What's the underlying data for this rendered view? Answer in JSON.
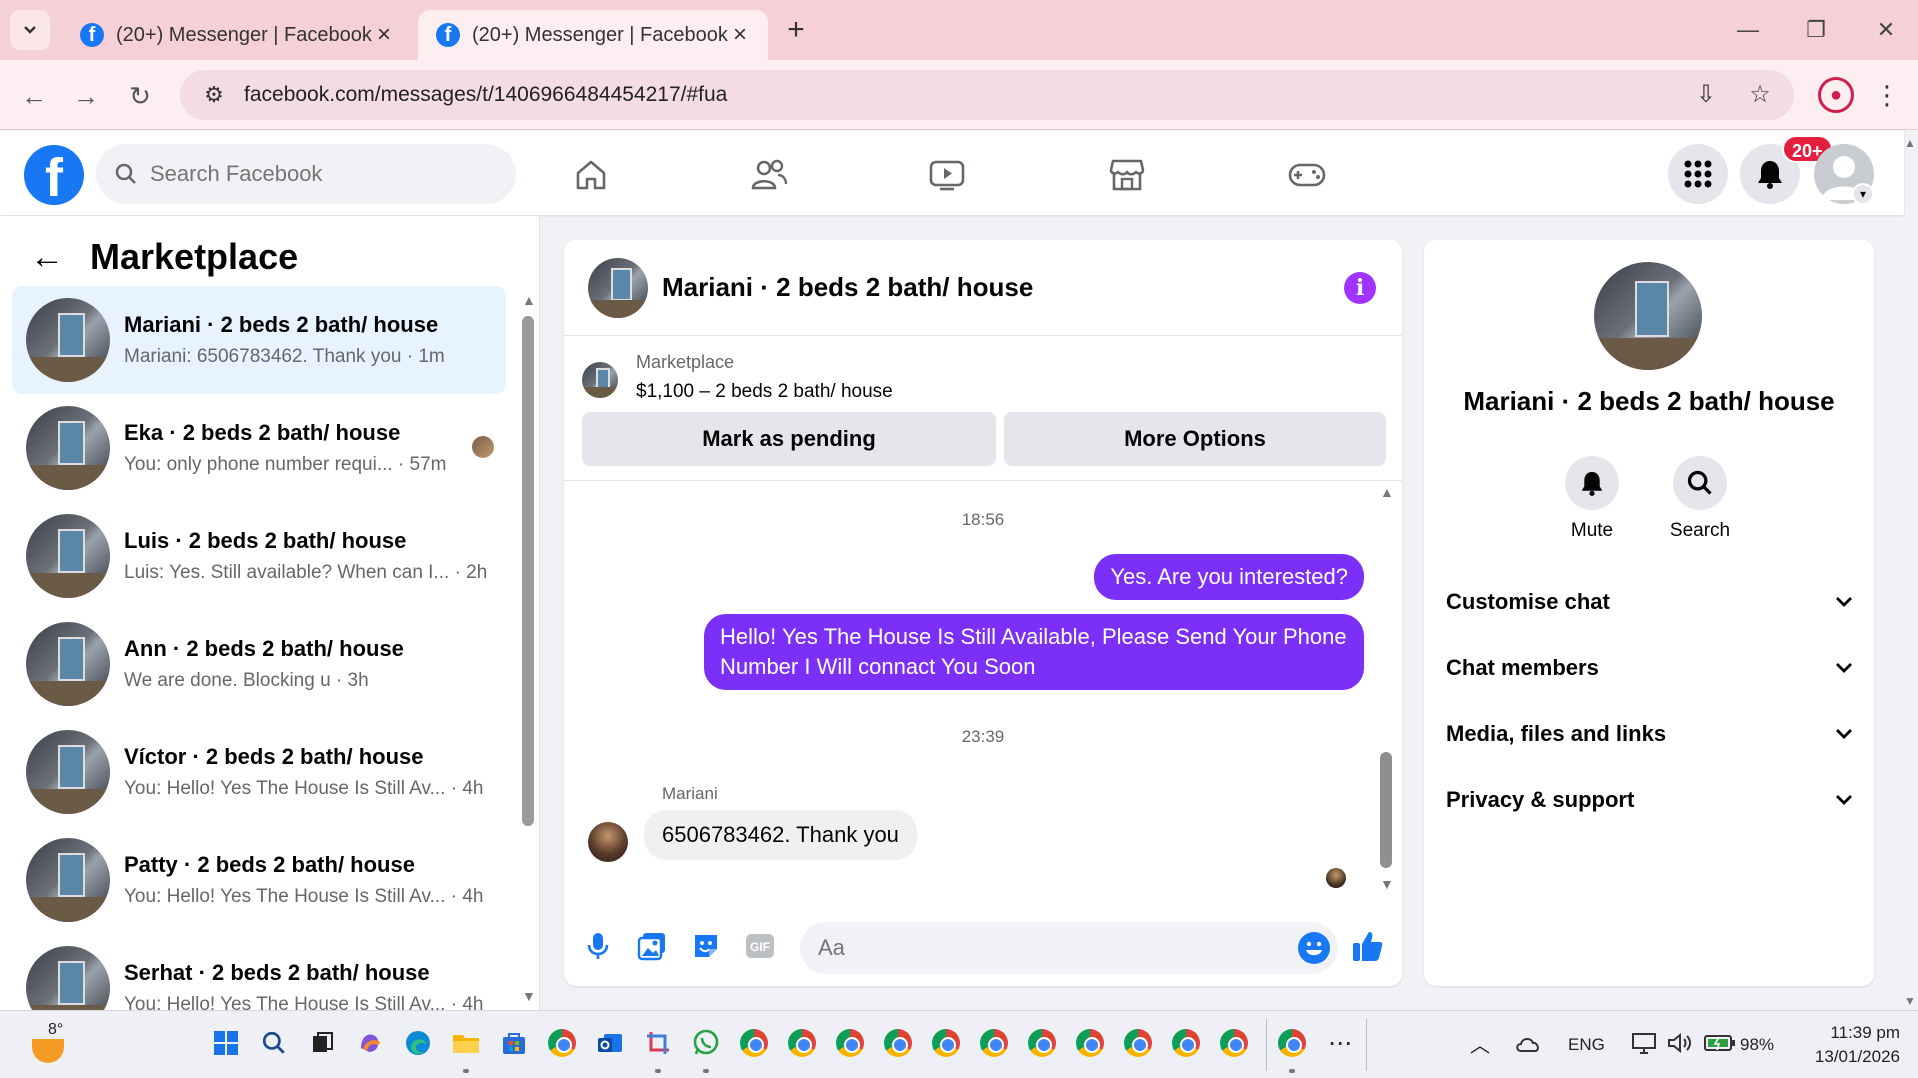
{
  "browser": {
    "tabs": [
      {
        "title": "(20+) Messenger | Facebook",
        "active": false
      },
      {
        "title": "(20+) Messenger | Facebook",
        "active": true
      }
    ],
    "url": "facebook.com/messages/t/1406966484454217/#fua"
  },
  "header": {
    "search_placeholder": "Search Facebook",
    "notification_badge": "20+"
  },
  "sidebar": {
    "title": "Marketplace",
    "conversations": [
      {
        "name": "Mariani · 2 beds 2 bath/ house",
        "preview": "Mariani: 6506783462. Thank you · 1m",
        "selected": true
      },
      {
        "name": "Eka · 2 beds 2 bath/ house",
        "preview": "You: only phone number requi... · 57m",
        "selected": false
      },
      {
        "name": "Luis · 2 beds 2 bath/ house",
        "preview": "Luis: Yes. Still available? When can I... · 2h",
        "selected": false
      },
      {
        "name": "Ann · 2 beds 2 bath/ house",
        "preview": "We are done. Blocking u · 3h",
        "selected": false
      },
      {
        "name": "Víctor · 2 beds 2 bath/ house",
        "preview": "You: Hello! Yes The House Is Still Av... · 4h",
        "selected": false
      },
      {
        "name": "Patty · 2 beds 2 bath/ house",
        "preview": "You: Hello! Yes The House Is Still Av... · 4h",
        "selected": false
      },
      {
        "name": "Serhat · 2 beds 2 bath/ house",
        "preview": "You: Hello! Yes The House Is Still Av... · 4h",
        "selected": false
      }
    ]
  },
  "chat": {
    "title": "Mariani · 2 beds 2 bath/ house",
    "listing_label": "Marketplace",
    "listing_price": "$1,100 – 2 beds 2 bath/ house",
    "mark_pending_label": "Mark as pending",
    "more_options_label": "More Options",
    "time1": "18:56",
    "msg_out_1": "Yes. Are you interested?",
    "msg_out_2": "Hello! Yes The House  Is Still Available, Please Send Your Phone Number I Will connact You Soon",
    "time2": "23:39",
    "sender_name": "Mariani",
    "msg_in_1": "6506783462. Thank you",
    "composer_placeholder": "Aa"
  },
  "info_panel": {
    "name": "Mariani · 2 beds 2 bath/ house",
    "mute_label": "Mute",
    "search_label": "Search",
    "sections": [
      "Customise chat",
      "Chat members",
      "Media, files and links",
      "Privacy & support"
    ]
  },
  "taskbar": {
    "temperature": "8°",
    "language": "ENG",
    "battery": "98%",
    "time": "11:39 pm",
    "date": "13/01/2026"
  },
  "colors": {
    "fb_blue": "#1877f2",
    "outgoing_bubble": "#7b2ff7",
    "info_purple": "#a033ff",
    "badge_red": "#e41e3f"
  }
}
